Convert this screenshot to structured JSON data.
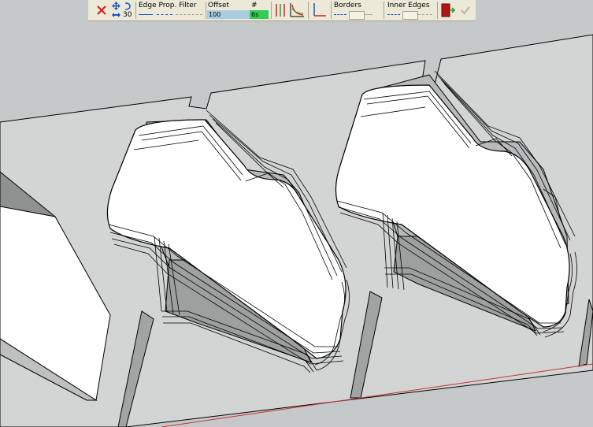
{
  "toolbar": {
    "cancel_icon": "close-icon",
    "move_icon": "move-arrows-icon",
    "rotate_icon": "rotate-arrow-icon",
    "width_icon": "horizontal-arrows-icon",
    "width_value": "30",
    "edge_filter_label": "Edge Prop. Filter",
    "offset_label": "Offset",
    "offset_value": "100",
    "count_label": "#",
    "count_value": "6s",
    "borders_label": "Borders",
    "inner_edges_label": "Inner Edges",
    "exit_icon": "exit-door-icon",
    "validate_icon": "checkmark-icon",
    "colors": {
      "toolbar_bg": "#ece9d8",
      "offset_field": "#a9cde0",
      "count_field": "#33cc55",
      "cancel": "#d42020",
      "move": "#1b55c8"
    }
  },
  "scene": {
    "background": "#c6c9ca",
    "red_axis": "#c83232"
  }
}
